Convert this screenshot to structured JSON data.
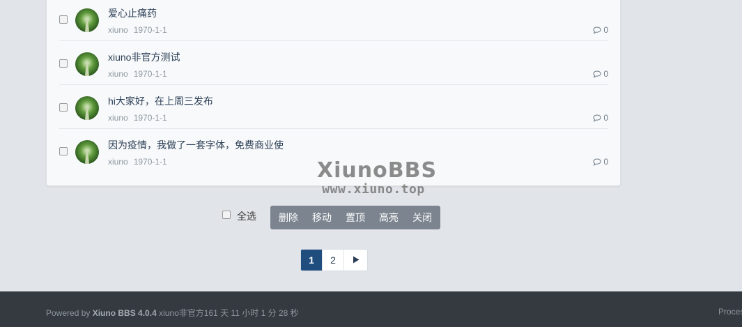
{
  "threads": [
    {
      "title": "爱心止痛药",
      "author": "xiuno",
      "date": "1970-1-1",
      "replies": "0"
    },
    {
      "title": "xiuno非官方测试",
      "author": "xiuno",
      "date": "1970-1-1",
      "replies": "0"
    },
    {
      "title": "hi大家好，在上周三发布",
      "author": "xiuno",
      "date": "1970-1-1",
      "replies": "0"
    },
    {
      "title": "因为疫情，我做了一套字体，免费商业使",
      "author": "xiuno",
      "date": "1970-1-1",
      "replies": "0"
    }
  ],
  "watermark": {
    "name": "XiunoBBS",
    "url": "www.xiuno.top"
  },
  "batch": {
    "select_all": "全选",
    "buttons": [
      "删除",
      "移动",
      "置顶",
      "高亮",
      "关闭"
    ]
  },
  "pagination": {
    "pages": [
      "1",
      "2"
    ],
    "current": "1",
    "next_icon": "next-arrow-icon"
  },
  "footer": {
    "powered_prefix": "Powered by",
    "product": "Xiuno BBS 4.0.4",
    "uptime": "xiuno非官方161 天 11 小时 1 分 28 秒",
    "right_text": "Proces"
  },
  "colors": {
    "accent": "#1f4d7d",
    "batch_bg": "#7b848f",
    "footer_bg": "#343a40",
    "page_bg": "#e1e4e8"
  }
}
